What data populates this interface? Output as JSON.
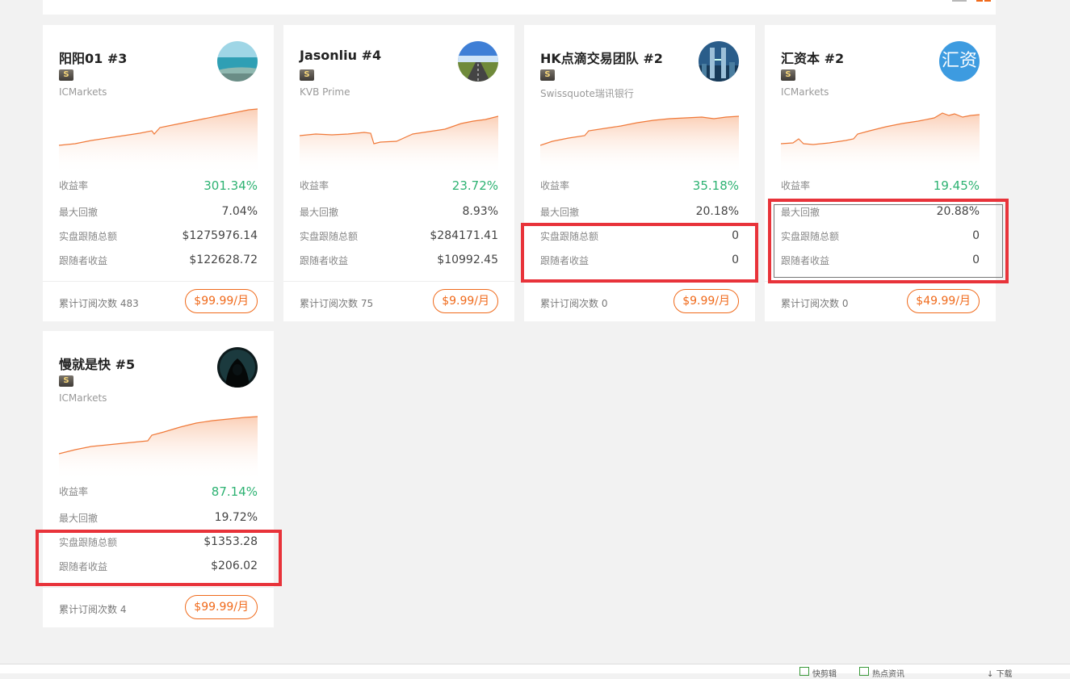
{
  "colors": {
    "accent": "#f06a1b",
    "positive": "#2db272",
    "highlight": "#e8333a",
    "avatar_text_bg": "#3d9be0"
  },
  "labels": {
    "return_rate": "收益率",
    "max_drawdown": "最大回撤",
    "live_follow_total": "实盘跟随总额",
    "follower_profit": "跟随者收益",
    "subscriptions": "累计订阅次数",
    "level_badge": "S"
  },
  "cards": [
    {
      "title": "阳阳01 #3",
      "broker": "ICMarkets",
      "avatar": "sea-photo",
      "return_rate": "301.34%",
      "max_drawdown": "7.04%",
      "live_follow_total": "$1275976.14",
      "follower_profit": "$122628.72",
      "subscriptions": "483",
      "price": "$99.99/月"
    },
    {
      "title": "Jasonliu #4",
      "broker": "KVB Prime",
      "avatar": "road-photo",
      "return_rate": "23.72%",
      "max_drawdown": "8.93%",
      "live_follow_total": "$284171.41",
      "follower_profit": "$10992.45",
      "subscriptions": "75",
      "price": "$9.99/月"
    },
    {
      "title": "HK点滴交易团队 #2",
      "broker": "Swissquote瑞讯银行",
      "avatar": "city-photo",
      "return_rate": "35.18%",
      "max_drawdown": "20.18%",
      "live_follow_total": "0",
      "follower_profit": "0",
      "subscriptions": "0",
      "price": "$9.99/月"
    },
    {
      "title": "汇资本 #2",
      "broker": "ICMarkets",
      "avatar": "text-avatar",
      "avatar_text": "汇资",
      "return_rate": "19.45%",
      "max_drawdown": "20.88%",
      "live_follow_total": "0",
      "follower_profit": "0",
      "subscriptions": "0",
      "price": "$49.99/月"
    },
    {
      "title": "慢就是快 #5",
      "broker": "ICMarkets",
      "avatar": "hooded-figure-photo",
      "return_rate": "87.14%",
      "max_drawdown": "19.72%",
      "live_follow_total": "$1353.28",
      "follower_profit": "$206.02",
      "subscriptions": "4",
      "price": "$99.99/月"
    }
  ],
  "bottom_bar": [
    "快剪辑",
    "热点资讯",
    "下载"
  ]
}
